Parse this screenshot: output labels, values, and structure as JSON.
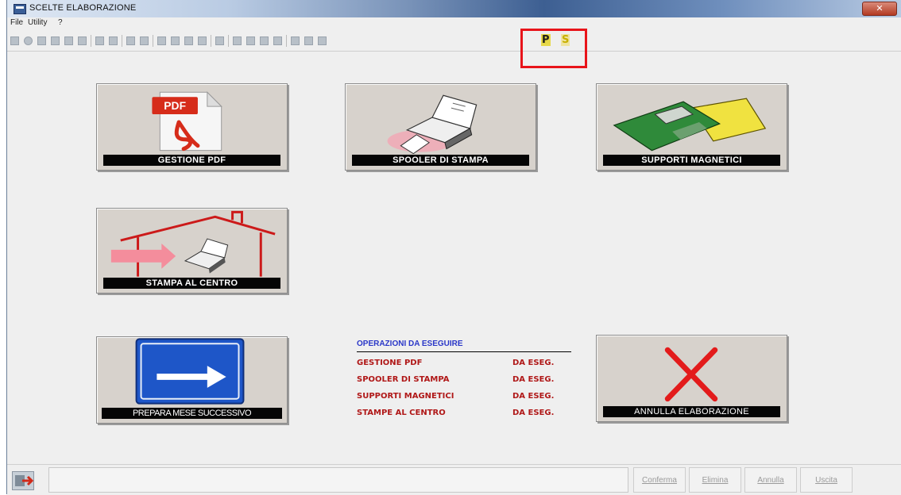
{
  "window": {
    "title": "SCELTE ELABORAZIONE",
    "close_label": "✕"
  },
  "menu": {
    "items": [
      "File",
      "Utility",
      "?"
    ]
  },
  "toolbar": {
    "p_button": "P",
    "s_button": "S"
  },
  "tiles": {
    "gestione_pdf": {
      "label": "GESTIONE PDF",
      "icon_text": "PDF"
    },
    "spooler": {
      "label": "SPOOLER DI STAMPA"
    },
    "supporti": {
      "label": "SUPPORTI MAGNETICI"
    },
    "stampa_centro": {
      "label": "STAMPA AL CENTRO"
    },
    "prepara": {
      "label": "PREPARA MESE SUCCESSIVO"
    },
    "annulla": {
      "label": "ANNULLA ELABORAZIONE"
    }
  },
  "operations": {
    "title": "OPERAZIONI DA ESEGUIRE",
    "rows": [
      {
        "name": "GESTIONE PDF",
        "status": "DA ESEG."
      },
      {
        "name": "SPOOLER DI STAMPA",
        "status": "DA ESEG."
      },
      {
        "name": "SUPPORTI MAGNETICI",
        "status": "DA ESEG."
      },
      {
        "name": "STAMPE AL CENTRO",
        "status": "DA ESEG."
      }
    ]
  },
  "statusbar": {
    "buttons": [
      "Conferma",
      "Elimina",
      "Annulla",
      "Uscita"
    ]
  },
  "colors": {
    "accent_highlight": "#e8141a",
    "ops_title": "#2a37c8",
    "ops_text": "#b01818"
  }
}
